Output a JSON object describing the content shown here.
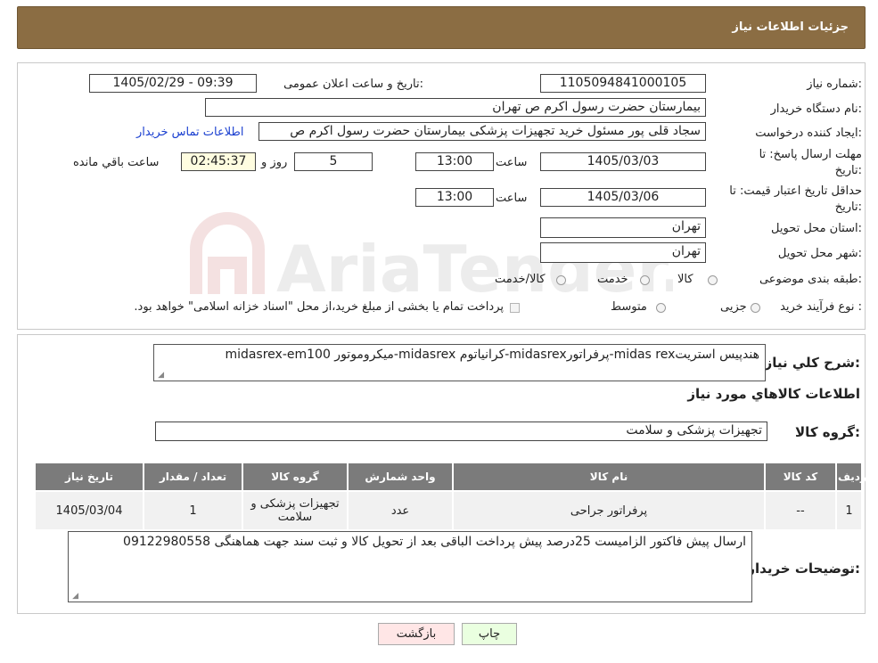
{
  "header": {
    "title": "جزئیات اطلاعات نیاز"
  },
  "fields": {
    "need_number_label": "شماره نیاز:",
    "need_number": "1105094841000105",
    "announce_label": "تاریخ و ساعت اعلان عمومی:",
    "announce_value": "1405/02/29 - 09:39",
    "buyer_org_label": "نام دستگاه خریدار:",
    "buyer_org": "بیمارستان حضرت رسول اکرم ص  تهران",
    "creator_label": "ایجاد کننده درخواست:",
    "creator": "سجاد قلی پور مسئول خرید تجهیزات پزشکی  بیمارستان حضرت رسول اکرم ص",
    "contact_link": "اطلاعات تماس خریدار",
    "deadline_label_1": "مهلت ارسال پاسخ: تا",
    "deadline_label_2": "تاریخ:",
    "deadline_date": "1405/03/03",
    "time_label": "ساعت",
    "deadline_time": "13:00",
    "days_value": "5",
    "days_label": "روز و",
    "remaining_time": "02:45:37",
    "remaining_label": "ساعت باقي مانده",
    "validity_label_1": "حداقل تاریخ اعتبار قیمت: تا",
    "validity_label_2": "تاریخ:",
    "validity_date": "1405/03/06",
    "validity_time": "13:00",
    "province_label": "استان محل تحویل:",
    "province": "تهران",
    "city_label": "شهر محل تحویل:",
    "city": "تهران",
    "category_label": "طبقه بندی موضوعی:",
    "category_options": [
      "کالا",
      "خدمت",
      "کالا/خدمت"
    ],
    "process_label": "نوع فرآیند خرید :",
    "process_options": [
      "جزیی",
      "متوسط"
    ],
    "process_note": "پرداخت تمام یا بخشی از مبلغ خرید،از محل \"اسناد خزانه اسلامی\" خواهد بود."
  },
  "summary": {
    "label": "شرح کلي نياز:",
    "text": "هندپیس استریتmidas rex-پرفراتورmidasrex-کرانیاتوم midasrex-میکروموتور midasrex-em100"
  },
  "goods_section": {
    "title": "اطلاعات کالاهاي مورد نياز",
    "group_label": "گروه کالا:",
    "group_value": "تجهیزات پزشکی و سلامت"
  },
  "table": {
    "headers": [
      "رديف",
      "کد کالا",
      "نام کالا",
      "واحد شمارش",
      "گروه کالا",
      "تعداد / مقدار",
      "تاریخ نیاز"
    ],
    "rows": [
      [
        "1",
        "--",
        "پرفراتور جراحی",
        "عدد",
        "تجهیزات پزشکی و سلامت",
        "1",
        "1405/03/04"
      ]
    ]
  },
  "buyer_notes": {
    "label": "توضیحات خریدار:",
    "text": "ارسال پیش فاکتور الزامیست 25درصد پیش پرداخت الباقی بعد از تحویل کالا و ثبت سند جهت هماهنگی 09122980558"
  },
  "buttons": {
    "print": "چاپ",
    "back": "بازگشت"
  },
  "watermark_text": "AriaTender.neT",
  "colors": {
    "header_bg": "#8b6d43",
    "link": "#1a3fd0",
    "print_bg": "#eaffe0",
    "back_bg": "#ffe6e6"
  }
}
